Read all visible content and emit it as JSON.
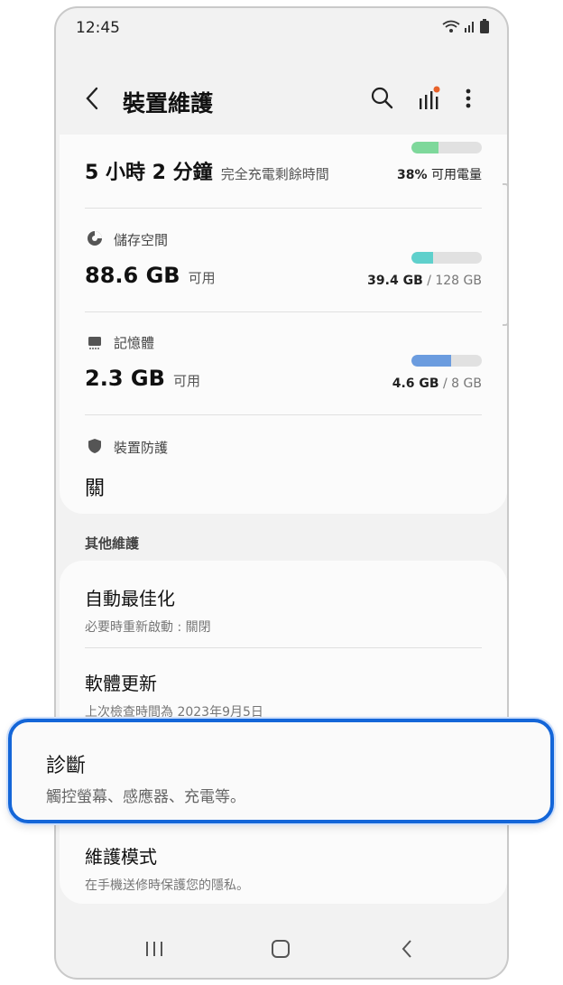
{
  "status_bar": {
    "time": "12:45"
  },
  "header": {
    "title": "裝置維護"
  },
  "battery": {
    "time_value": "5 小時 2 分鐘",
    "time_caption": "完全充電剩餘時間",
    "percent_value": "38%",
    "percent_caption": "可用電量",
    "level": 0.38,
    "color": "#7ed89b"
  },
  "storage": {
    "label": "儲存空間",
    "value": "88.6 GB",
    "unit": "可用",
    "used": "39.4 GB",
    "total": "/ 128 GB",
    "level": 0.31,
    "color": "#5fd0cc"
  },
  "memory": {
    "label": "記憶體",
    "value": "2.3 GB",
    "unit": "可用",
    "used": "4.6 GB",
    "total": "/ 8 GB",
    "level": 0.57,
    "color": "#6b9cdf"
  },
  "protection": {
    "label": "裝置防護",
    "value": "關"
  },
  "other": {
    "section_title": "其他維護",
    "items": [
      {
        "title": "自動最佳化",
        "subtitle": "必要時重新啟動 : 關閉"
      },
      {
        "title": "軟體更新",
        "subtitle": "上次檢查時間為 2023年9月5日"
      },
      {
        "title": "診斷",
        "subtitle": "觸控螢幕、感應器、充電等。"
      },
      {
        "title": "維護模式",
        "subtitle": "在手機送修時保護您的隱私。"
      }
    ]
  },
  "accent": "#1466d8"
}
